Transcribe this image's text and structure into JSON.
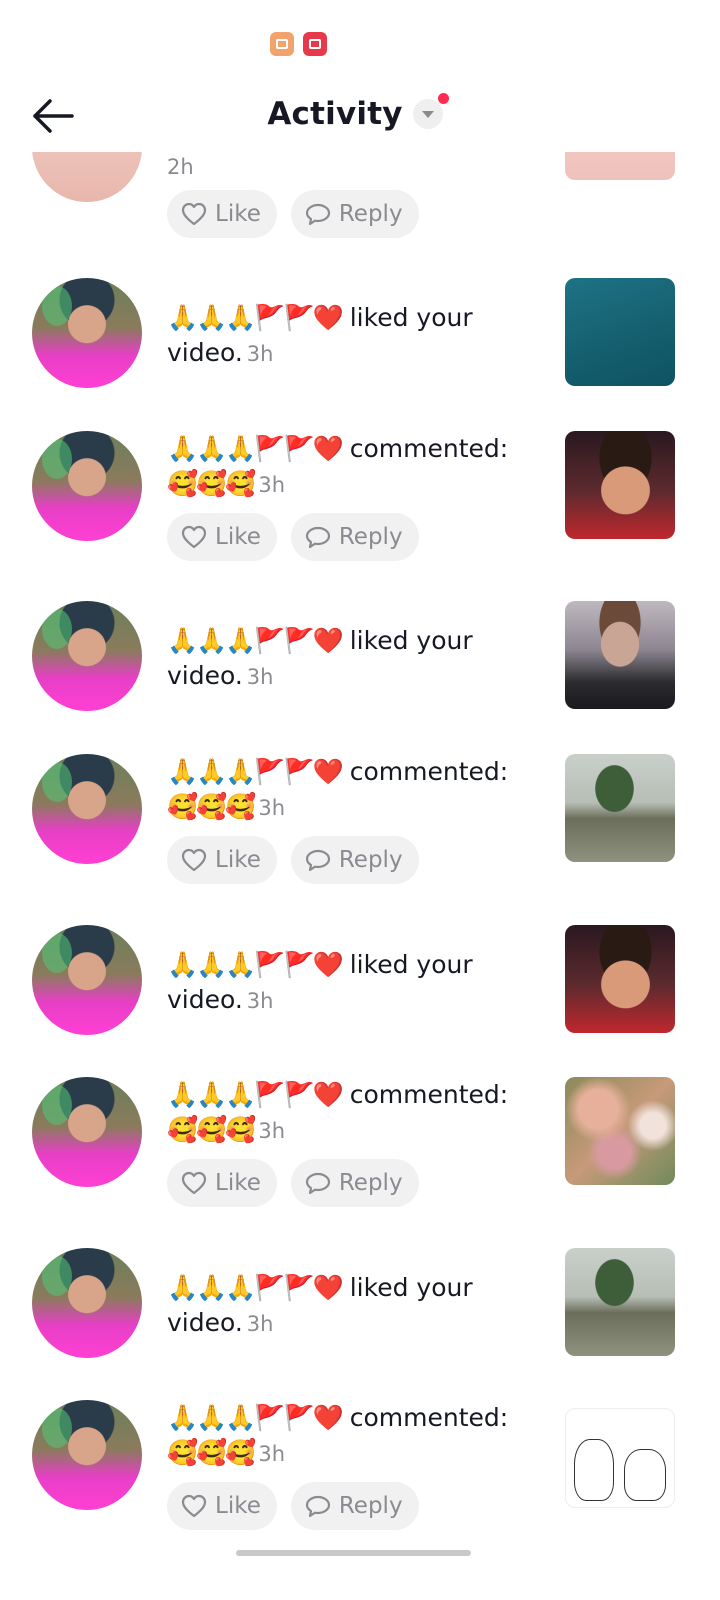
{
  "header": {
    "title": "Activity",
    "has_notification": true
  },
  "status_icons": [
    "stats-app-icon",
    "video-app-icon"
  ],
  "partial_top_item": {
    "time": "2h",
    "like_label": "Like",
    "reply_label": "Reply"
  },
  "items": [
    {
      "type": "like",
      "emoji": "🙏🙏🙏🚩🚩❤️",
      "action": "liked your",
      "action2": "video.",
      "time": "3h",
      "thumb": "t-teal"
    },
    {
      "type": "comment",
      "emoji": "🙏🙏🙏🚩🚩❤️",
      "action": "commented:",
      "comment": "🥰🥰🥰",
      "time": "3h",
      "thumb": "t-face",
      "like_label": "Like",
      "reply_label": "Reply"
    },
    {
      "type": "like",
      "emoji": "🙏🙏🙏🚩🚩❤️",
      "action": "liked your",
      "action2": "video.",
      "time": "3h",
      "thumb": "t-face2"
    },
    {
      "type": "comment",
      "emoji": "🙏🙏🙏🚩🚩❤️",
      "action": "commented:",
      "comment": "🥰🥰🥰",
      "time": "3h",
      "thumb": "t-tree",
      "like_label": "Like",
      "reply_label": "Reply"
    },
    {
      "type": "like",
      "emoji": "🙏🙏🙏🚩🚩❤️",
      "action": "liked your",
      "action2": "video.",
      "time": "3h",
      "thumb": "t-face"
    },
    {
      "type": "comment",
      "emoji": "🙏🙏🙏🚩🚩❤️",
      "action": "commented:",
      "comment": "🥰🥰🥰",
      "time": "3h",
      "thumb": "t-blur",
      "like_label": "Like",
      "reply_label": "Reply"
    },
    {
      "type": "like",
      "emoji": "🙏🙏🙏🚩🚩❤️",
      "action": "liked your",
      "action2": "video.",
      "time": "3h",
      "thumb": "t-tree"
    },
    {
      "type": "comment",
      "emoji": "🙏🙏🙏🚩🚩❤️",
      "action": "commented:",
      "comment": "🥰🥰🥰",
      "time": "3h",
      "thumb": "t-sketch",
      "like_label": "Like",
      "reply_label": "Reply"
    }
  ]
}
